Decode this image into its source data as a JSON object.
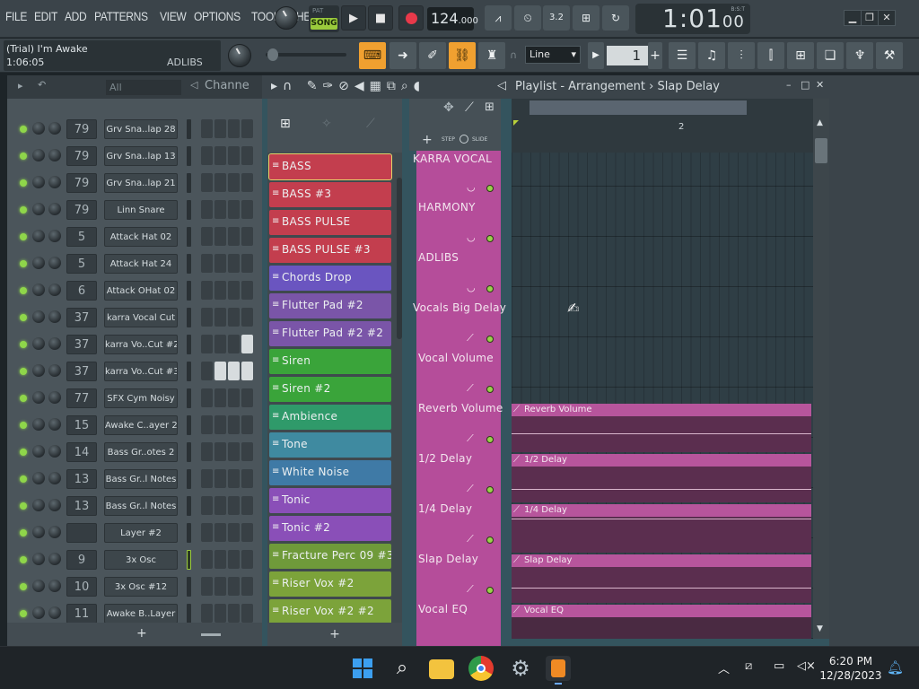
{
  "menu": [
    "FILE",
    "EDIT",
    "ADD",
    "PATTERNS",
    "VIEW",
    "OPTIONS",
    "TOOLS",
    "HELP"
  ],
  "transport": {
    "mode_pat": "PAT",
    "mode_song": "SONG",
    "tempo_int": "124",
    "tempo_dec": ".000",
    "time": "1:01",
    "time_small": "00",
    "time_unit": "B:S:T"
  },
  "hint": {
    "project": "(Trial) I'm Awake",
    "position": "1:06:05",
    "focus": "ADLIBS"
  },
  "toolbar": {
    "snap": "Line",
    "pattern_number": "1"
  },
  "rack": {
    "filter": "All",
    "title": "Channe",
    "add": "+",
    "channels": [
      {
        "mix": "79",
        "name": "Grv Sna..lap 28",
        "selected": false,
        "steps": [
          0,
          0,
          0,
          0
        ]
      },
      {
        "mix": "79",
        "name": "Grv Sna..lap 13",
        "selected": false,
        "steps": [
          0,
          0,
          0,
          0
        ]
      },
      {
        "mix": "79",
        "name": "Grv Sna..lap 21",
        "selected": false,
        "steps": [
          0,
          0,
          0,
          0
        ]
      },
      {
        "mix": "79",
        "name": "Linn Snare",
        "selected": false,
        "steps": [
          0,
          0,
          0,
          0
        ]
      },
      {
        "mix": "5",
        "name": "Attack Hat 02",
        "selected": false,
        "steps": [
          0,
          0,
          0,
          0
        ]
      },
      {
        "mix": "5",
        "name": "Attack Hat 24",
        "selected": false,
        "steps": [
          0,
          0,
          0,
          0
        ]
      },
      {
        "mix": "6",
        "name": "Attack OHat 02",
        "selected": false,
        "steps": [
          0,
          0,
          0,
          0
        ]
      },
      {
        "mix": "37",
        "name": "karra Vocal Cut",
        "selected": false,
        "steps": [
          0,
          0,
          0,
          0
        ]
      },
      {
        "mix": "37",
        "name": "karra Vo..Cut #2",
        "selected": false,
        "steps": [
          0,
          0,
          0,
          1
        ]
      },
      {
        "mix": "37",
        "name": "karra Vo..Cut #3",
        "selected": false,
        "steps": [
          0,
          1,
          1,
          1
        ]
      },
      {
        "mix": "77",
        "name": "SFX Cym Noisy",
        "selected": false,
        "steps": [
          0,
          0,
          0,
          0
        ]
      },
      {
        "mix": "15",
        "name": "Awake C..ayer 2",
        "selected": false,
        "steps": [
          0,
          0,
          0,
          0
        ]
      },
      {
        "mix": "14",
        "name": "Bass Gr..otes 2",
        "selected": false,
        "steps": [
          0,
          0,
          0,
          0
        ]
      },
      {
        "mix": "13",
        "name": "Bass Gr..l Notes",
        "selected": false,
        "steps": [
          0,
          0,
          0,
          0
        ]
      },
      {
        "mix": "13",
        "name": "Bass Gr..l Notes",
        "selected": false,
        "steps": [
          0,
          0,
          0,
          0
        ]
      },
      {
        "mix": "",
        "name": "Layer #2",
        "selected": false,
        "steps": [
          0,
          0,
          0,
          0
        ]
      },
      {
        "mix": "9",
        "name": "3x Osc",
        "selected": true,
        "steps": [
          0,
          0,
          0,
          0
        ]
      },
      {
        "mix": "10",
        "name": "3x Osc #12",
        "selected": false,
        "steps": [
          0,
          0,
          0,
          0
        ]
      },
      {
        "mix": "11",
        "name": "Awake B..Layer",
        "selected": false,
        "steps": [
          0,
          0,
          0,
          0
        ]
      }
    ]
  },
  "playlist": {
    "title": "Playlist - Arrangement",
    "current_clip": "Slap Delay",
    "ruler_bar": "2",
    "step_label": "STEP",
    "slide_label": "SLIDE",
    "picker_add": "+",
    "picker_items": [
      {
        "name": "BASS",
        "color": "#c33e4e"
      },
      {
        "name": "BASS #3",
        "color": "#c33e4e"
      },
      {
        "name": "BASS PULSE",
        "color": "#c33e4e"
      },
      {
        "name": "BASS PULSE #3",
        "color": "#c33e4e"
      },
      {
        "name": "Chords  Drop",
        "color": "#6a55c0"
      },
      {
        "name": "Flutter Pad #2",
        "color": "#7a55a8"
      },
      {
        "name": "Flutter Pad #2 #2",
        "color": "#7a55a8"
      },
      {
        "name": "Siren",
        "color": "#3aa43a"
      },
      {
        "name": "Siren #2",
        "color": "#3aa43a"
      },
      {
        "name": "Ambience",
        "color": "#2f9a6a"
      },
      {
        "name": "Tone",
        "color": "#3f8aa0"
      },
      {
        "name": "White Noise",
        "color": "#3f7aa6"
      },
      {
        "name": "Tonic",
        "color": "#8a4fb8"
      },
      {
        "name": "Tonic #2",
        "color": "#8a4fb8"
      },
      {
        "name": "Fracture Perc 09 #3",
        "color": "#6f9a3a"
      },
      {
        "name": "Riser Vox #2",
        "color": "#7ca33a"
      },
      {
        "name": "Riser Vox #2 #2",
        "color": "#7ca33a"
      }
    ],
    "tracks": [
      "KARRA VOCAL",
      "HARMONY",
      "ADLIBS",
      "Vocals Big Delay",
      "Vocal Volume",
      "Reverb Volume",
      "1/2 Delay",
      "1/4 Delay",
      "Slap Delay",
      "Vocal EQ"
    ],
    "clips": [
      {
        "label": "Reverb Volume",
        "line_level": 0.5
      },
      {
        "label": "1/2 Delay",
        "line_level": 0.35
      },
      {
        "label": "1/4 Delay",
        "line_level": 0.95
      },
      {
        "label": "Slap Delay",
        "line_level": 0.4
      },
      {
        "label": "Vocal EQ",
        "line_level": 0.0
      }
    ]
  },
  "taskbar": {
    "time": "6:20 PM",
    "date": "12/28/2023"
  },
  "colors": {
    "accent_orange": "#f0a030",
    "song_green": "#9acb3c",
    "track_pink": "#b54d9a"
  }
}
